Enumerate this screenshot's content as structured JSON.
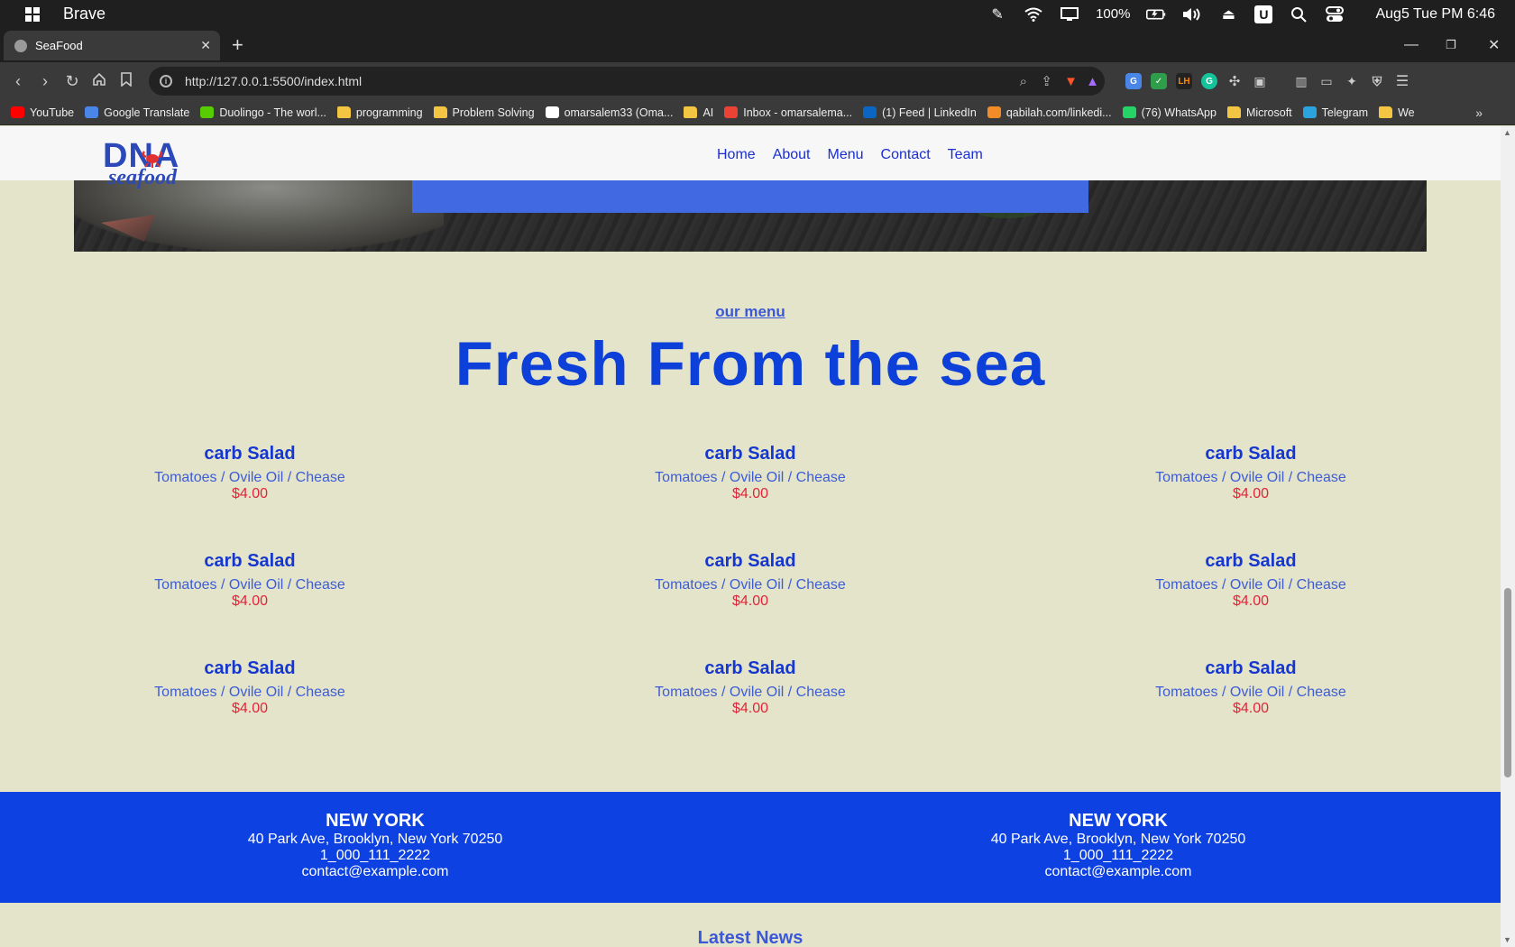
{
  "os": {
    "app_name": "Brave",
    "battery": "100%",
    "clock": "Aug5 Tue PM 6:46",
    "u_badge": "U"
  },
  "browser": {
    "tab_title": "SeaFood",
    "url": "http://127.0.0.1:5500/index.html",
    "bookmarks": [
      {
        "label": "YouTube",
        "icon": "youtube-icon",
        "color": "#ff0000"
      },
      {
        "label": "Google Translate",
        "icon": "translate-icon",
        "color": "#4a86e8"
      },
      {
        "label": "Duolingo - The worl...",
        "icon": "duolingo-icon",
        "color": "#58cc02"
      },
      {
        "label": "programming",
        "icon": "folder-icon",
        "color": "#f4c542"
      },
      {
        "label": "Problem Solving",
        "icon": "folder-icon",
        "color": "#f4c542"
      },
      {
        "label": "omarsalem33 (Oma...",
        "icon": "github-icon",
        "color": "#ffffff"
      },
      {
        "label": "AI",
        "icon": "folder-icon",
        "color": "#f4c542"
      },
      {
        "label": "Inbox - omarsalema...",
        "icon": "gmail-icon",
        "color": "#ea4335"
      },
      {
        "label": "(1) Feed | LinkedIn",
        "icon": "linkedin-icon",
        "color": "#0a66c2"
      },
      {
        "label": "qabilah.com/linkedi...",
        "icon": "qabilah-icon",
        "color": "#f28c28"
      },
      {
        "label": "(76) WhatsApp",
        "icon": "whatsapp-icon",
        "color": "#25d366"
      },
      {
        "label": "Microsoft",
        "icon": "folder-icon",
        "color": "#f4c542"
      },
      {
        "label": "Telegram",
        "icon": "telegram-icon",
        "color": "#2aa3df"
      },
      {
        "label": "We",
        "icon": "folder-icon",
        "color": "#f4c542"
      }
    ]
  },
  "site": {
    "logo_word": "DNA",
    "logo_sub": "seafood",
    "nav": [
      "Home",
      "About",
      "Menu",
      "Contact",
      "Team"
    ],
    "menu_eyebrow": "our menu",
    "menu_title": "Fresh From the sea",
    "menu_items": [
      {
        "name": "carb Salad",
        "desc": "Tomatoes / Ovile Oil / Chease",
        "price": "$4.00"
      },
      {
        "name": "carb Salad",
        "desc": "Tomatoes / Ovile Oil / Chease",
        "price": "$4.00"
      },
      {
        "name": "carb Salad",
        "desc": "Tomatoes / Ovile Oil / Chease",
        "price": "$4.00"
      },
      {
        "name": "carb Salad",
        "desc": "Tomatoes / Ovile Oil / Chease",
        "price": "$4.00"
      },
      {
        "name": "carb Salad",
        "desc": "Tomatoes / Ovile Oil / Chease",
        "price": "$4.00"
      },
      {
        "name": "carb Salad",
        "desc": "Tomatoes / Ovile Oil / Chease",
        "price": "$4.00"
      },
      {
        "name": "carb Salad",
        "desc": "Tomatoes / Ovile Oil / Chease",
        "price": "$4.00"
      },
      {
        "name": "carb Salad",
        "desc": "Tomatoes / Ovile Oil / Chease",
        "price": "$4.00"
      },
      {
        "name": "carb Salad",
        "desc": "Tomatoes / Ovile Oil / Chease",
        "price": "$4.00"
      }
    ],
    "locations": [
      {
        "city": "NEW YORK",
        "address": "40 Park Ave, Brooklyn, New York 70250",
        "phone": "1_000_111_2222",
        "email": "contact@example.com"
      },
      {
        "city": "NEW YORK",
        "address": "40 Park Ave, Brooklyn, New York 70250",
        "phone": "1_000_111_2222",
        "email": "contact@example.com"
      }
    ],
    "news_heading": "Latest News"
  },
  "colors": {
    "page_bg": "#e4e4ca",
    "brand_blue": "#0d41e1",
    "price_red": "#e0253a"
  }
}
